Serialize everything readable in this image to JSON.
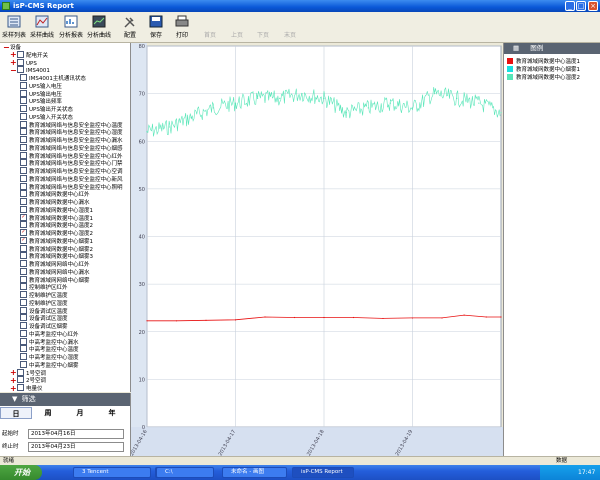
{
  "window": {
    "title": "isP-CMS Report"
  },
  "toolbar": [
    {
      "id": "collect-list",
      "label": "采样列表",
      "enabled": true
    },
    {
      "id": "collect-curve",
      "label": "采样曲线",
      "enabled": true
    },
    {
      "id": "analysis-report",
      "label": "分析报表",
      "enabled": true
    },
    {
      "id": "analysis-curve",
      "label": "分析曲线",
      "enabled": true
    },
    {
      "id": "config",
      "label": "配置",
      "enabled": true
    },
    {
      "id": "save",
      "label": "保存",
      "enabled": true
    },
    {
      "id": "print",
      "label": "打印",
      "enabled": true
    },
    {
      "id": "first-page",
      "label": "首页",
      "enabled": false
    },
    {
      "id": "prev-page",
      "label": "上页",
      "enabled": false
    },
    {
      "id": "next-page",
      "label": "下页",
      "enabled": false
    },
    {
      "id": "last-page",
      "label": "末页",
      "enabled": false
    }
  ],
  "tree": [
    {
      "label": "设备",
      "level": 0,
      "box": "minus"
    },
    {
      "label": "配电开关",
      "level": 1,
      "box": "plus"
    },
    {
      "label": "UPS",
      "level": 1,
      "box": "plus"
    },
    {
      "label": "IMS4001",
      "level": 1,
      "box": "minus"
    },
    {
      "label": "IMS4001主机通讯状态",
      "level": 2
    },
    {
      "label": "UPS输入电压",
      "level": 2
    },
    {
      "label": "UPS输出电压",
      "level": 2
    },
    {
      "label": "UPS输出频率",
      "level": 2
    },
    {
      "label": "UPS输出开关状态",
      "level": 2
    },
    {
      "label": "UPS输入开关状态",
      "level": 2
    },
    {
      "label": "教育城域网络与信息安全监控中心温度",
      "level": 2
    },
    {
      "label": "教育城域网络与信息安全监控中心湿度",
      "level": 2
    },
    {
      "label": "教育城域网络与信息安全监控中心漏水",
      "level": 2
    },
    {
      "label": "教育城域网络与信息安全监控中心烟感",
      "level": 2
    },
    {
      "label": "教育城域网络与信息安全监控中心红外",
      "level": 2
    },
    {
      "label": "教育城域网络与信息安全监控中心门禁",
      "level": 2
    },
    {
      "label": "教育城域网络与信息安全监控中心空调",
      "level": 2
    },
    {
      "label": "教育城域网络与信息安全监控中心新风",
      "level": 2
    },
    {
      "label": "教育城域网络与信息安全监控中心照明",
      "level": 2
    },
    {
      "label": "教育城域网数据中心红外",
      "level": 2
    },
    {
      "label": "教育城域网数据中心漏水",
      "level": 2
    },
    {
      "label": "教育城域网数据中心湿度1",
      "level": 2
    },
    {
      "label": "教育城域网数据中心温度1",
      "level": 2,
      "checked": true
    },
    {
      "label": "教育城域网数据中心温度2",
      "level": 2
    },
    {
      "label": "教育城域网数据中心湿度2",
      "level": 2,
      "checked": true
    },
    {
      "label": "教育城域网数据中心烟雾1",
      "level": 2,
      "checked": true
    },
    {
      "label": "教育城域网数据中心烟雾2",
      "level": 2
    },
    {
      "label": "教育城域网数据中心烟雾3",
      "level": 2
    },
    {
      "label": "教育城域网网络中心红外",
      "level": 2
    },
    {
      "label": "教育城域网网络中心漏水",
      "level": 2
    },
    {
      "label": "教育城域网网络中心烟雾",
      "level": 2
    },
    {
      "label": "控制维护区红外",
      "level": 2
    },
    {
      "label": "控制维护区温度",
      "level": 2
    },
    {
      "label": "控制维护区湿度",
      "level": 2
    },
    {
      "label": "设备调试区温度",
      "level": 2
    },
    {
      "label": "设备调试区湿度",
      "level": 2
    },
    {
      "label": "设备调试区烟雾",
      "level": 2
    },
    {
      "label": "中高考监控中心红外",
      "level": 2
    },
    {
      "label": "中高考监控中心漏水",
      "level": 2
    },
    {
      "label": "中高考监控中心温度",
      "level": 2
    },
    {
      "label": "中高考监控中心湿度",
      "level": 2
    },
    {
      "label": "中高考监控中心烟雾",
      "level": 2
    },
    {
      "label": "1号空调",
      "level": 1,
      "box": "plus"
    },
    {
      "label": "2号空调",
      "level": 1,
      "box": "plus"
    },
    {
      "label": "电量仪",
      "level": 1,
      "box": "plus"
    }
  ],
  "filter": {
    "header": "筛选",
    "tabs": [
      "日",
      "周",
      "月",
      "年"
    ],
    "active_tab": 0,
    "start_label": "起始时",
    "start_value": "2013年04月16日",
    "end_label": "终止时",
    "end_value": "2013年04月23日"
  },
  "legend": {
    "header": "图例",
    "items": [
      {
        "label": "教育城域网数据中心温度1",
        "color": "#e81010"
      },
      {
        "label": "教育城域网数据中心烟雾1",
        "color": "#17e0e0"
      },
      {
        "label": "教育城域网数据中心湿度2",
        "color": "#58e6b8"
      }
    ]
  },
  "status": {
    "left": "就绪",
    "right": "数据"
  },
  "taskbar": {
    "start": "开始",
    "tasks": [
      "3 Tencent",
      "isP-CMS中",
      "C:\\",
      "未命名 - 画图",
      "isP-CMS Report"
    ],
    "active_task": 4,
    "clock": "17:47"
  },
  "chart_data": {
    "type": "line",
    "ylim": [
      0,
      80
    ],
    "yticks": [
      0,
      10,
      20,
      30,
      40,
      50,
      60,
      70,
      80
    ],
    "xlim": [
      "2013-04-16",
      "2013-04-20"
    ],
    "xticks": [
      "2013-04-16",
      "2013-04-17",
      "2013-04-18",
      "2013-04-19"
    ],
    "grid": true,
    "series": [
      {
        "name": "教育城域网数据中心湿度2",
        "color": "#58e6b8",
        "x": [
          "2013-04-16 00:00",
          "2013-04-16 06:00",
          "2013-04-16 12:00",
          "2013-04-16 18:00",
          "2013-04-17 00:00",
          "2013-04-17 06:00",
          "2013-04-17 12:00",
          "2013-04-17 18:00",
          "2013-04-18 00:00",
          "2013-04-18 06:00",
          "2013-04-18 12:00",
          "2013-04-18 18:00",
          "2013-04-19 00:00",
          "2013-04-19 06:00",
          "2013-04-19 12:00",
          "2013-04-19 18:00",
          "2013-04-20 00:00"
        ],
        "values": [
          62,
          63,
          65,
          67,
          68,
          69,
          69,
          70,
          69,
          66,
          67,
          68,
          67,
          70,
          69,
          68,
          66
        ]
      },
      {
        "name": "教育城域网数据中心温度1",
        "color": "#e81010",
        "x": [
          "2013-04-16 00:00",
          "2013-04-16 08:00",
          "2013-04-16 16:00",
          "2013-04-17 00:00",
          "2013-04-17 08:00",
          "2013-04-17 16:00",
          "2013-04-18 00:00",
          "2013-04-18 08:00",
          "2013-04-18 16:00",
          "2013-04-19 00:00",
          "2013-04-19 08:00",
          "2013-04-19 14:00",
          "2013-04-19 20:00",
          "2013-04-20 00:00"
        ],
        "values": [
          22.3,
          22.3,
          22.4,
          22.5,
          23.1,
          23.0,
          23.0,
          23.0,
          22.8,
          22.9,
          22.9,
          23.5,
          23.1,
          23.1
        ]
      }
    ]
  }
}
